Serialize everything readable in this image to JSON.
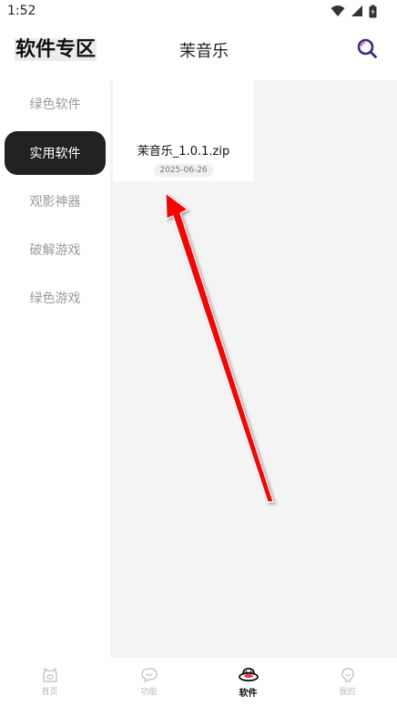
{
  "status_bar": {
    "time": "1:52"
  },
  "header": {
    "brand": "软件专区",
    "title": "茉音乐"
  },
  "sidebar": {
    "items": [
      {
        "label": "绿色软件",
        "active": false
      },
      {
        "label": "实用软件",
        "active": true
      },
      {
        "label": "观影神器",
        "active": false
      },
      {
        "label": "破解游戏",
        "active": false
      },
      {
        "label": "绿色游戏",
        "active": false
      }
    ]
  },
  "content": {
    "items": [
      {
        "name": "茉音乐_1.0.1.zip",
        "date": "2025-06-26"
      }
    ]
  },
  "bottom_nav": {
    "items": [
      {
        "label": "首页",
        "icon": "home-cat-icon",
        "active": false
      },
      {
        "label": "功能",
        "icon": "chat-bubble-icon",
        "active": false
      },
      {
        "label": "软件",
        "icon": "software-ufo-icon",
        "active": true
      },
      {
        "label": "我的",
        "icon": "profile-icon",
        "active": false
      }
    ]
  },
  "colors": {
    "active_bg": "#222222",
    "content_bg": "#f4f4f4",
    "search_accent": "#3a2a86",
    "annotation_arrow": "#ff0000"
  }
}
